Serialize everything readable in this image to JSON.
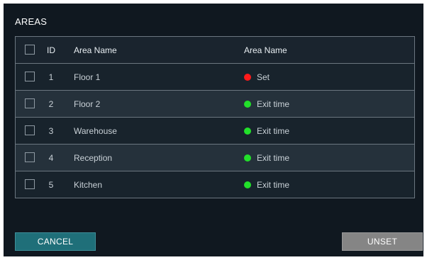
{
  "title": "AREAS",
  "table": {
    "headers": {
      "id": "ID",
      "name": "Area Name",
      "status": "Area Name"
    },
    "rows": [
      {
        "id": "1",
        "name": "Floor 1",
        "status": "Set",
        "status_color": "#ff1a1a",
        "checked": false
      },
      {
        "id": "2",
        "name": "Floor 2",
        "status": "Exit time",
        "status_color": "#22e02a",
        "checked": false
      },
      {
        "id": "3",
        "name": "Warehouse",
        "status": "Exit time",
        "status_color": "#22e02a",
        "checked": false
      },
      {
        "id": "4",
        "name": "Reception",
        "status": "Exit time",
        "status_color": "#22e02a",
        "checked": false
      },
      {
        "id": "5",
        "name": "Kitchen",
        "status": "Exit time",
        "status_color": "#22e02a",
        "checked": false
      }
    ]
  },
  "buttons": {
    "cancel": "CANCEL",
    "unset": "UNSET"
  },
  "colors": {
    "background": "#101820",
    "row": "#18232c",
    "row_alt": "#25313b",
    "cancel_button": "#1f6f79",
    "unset_button": "#858585"
  }
}
